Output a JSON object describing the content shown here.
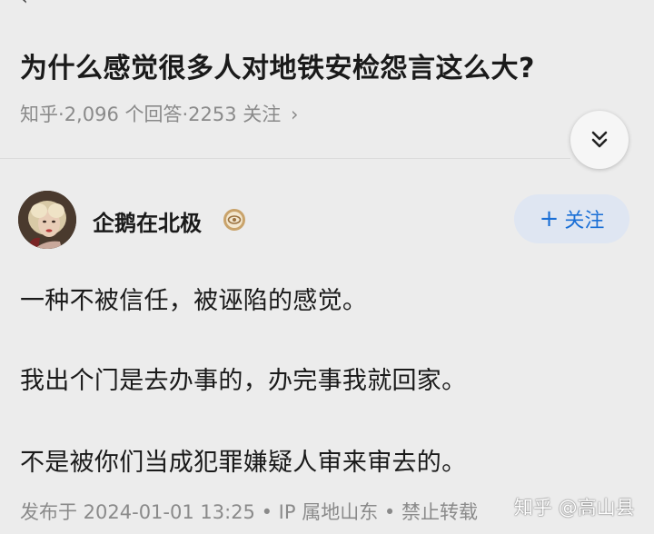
{
  "question": {
    "title": "为什么感觉很多人对地铁安检怨言这么大?",
    "source": "知乎",
    "answer_count": "2,096 个回答",
    "follower_count": "2253 关注",
    "sep": " · ",
    "chevron": "›"
  },
  "author": {
    "name": "企鹅在北极",
    "follow_label": "关注",
    "follow_plus": "+"
  },
  "answer": {
    "paragraphs": [
      "一种不被信任，被诬陷的感觉。",
      "我出个门是去办事的，办完事我就回家。",
      "不是被你们当成犯罪嫌疑人审来审去的。"
    ],
    "published": "发布于 2024-01-01 13:25",
    "ip_location": "IP 属地山东",
    "copyright": "禁止转载",
    "dot": " • "
  },
  "watermark": "知乎 @高山县",
  "icons": {
    "expand": "double-chevron-down-icon",
    "badge": "eye-badge-icon"
  },
  "colors": {
    "background": "#ececec",
    "accent": "#1a6fd6",
    "follow_bg": "#dfe6f2",
    "meta_text": "#8a8a8a"
  }
}
